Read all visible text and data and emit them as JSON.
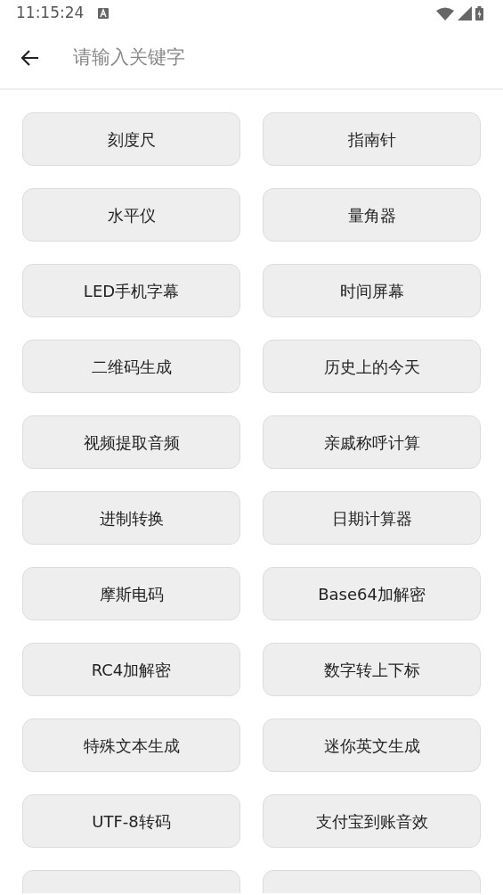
{
  "status_bar": {
    "time": "11:15:24"
  },
  "search": {
    "placeholder": "请输入关键字"
  },
  "tools": [
    {
      "label": "刻度尺"
    },
    {
      "label": "指南针"
    },
    {
      "label": "水平仪"
    },
    {
      "label": "量角器"
    },
    {
      "label": "LED手机字幕"
    },
    {
      "label": "时间屏幕"
    },
    {
      "label": "二维码生成"
    },
    {
      "label": "历史上的今天"
    },
    {
      "label": "视频提取音频"
    },
    {
      "label": "亲戚称呼计算"
    },
    {
      "label": "进制转换"
    },
    {
      "label": "日期计算器"
    },
    {
      "label": "摩斯电码"
    },
    {
      "label": "Base64加解密"
    },
    {
      "label": "RC4加解密"
    },
    {
      "label": "数字转上下标"
    },
    {
      "label": "特殊文本生成"
    },
    {
      "label": "迷你英文生成"
    },
    {
      "label": "UTF-8转码"
    },
    {
      "label": "支付宝到账音效"
    },
    {
      "kind": "cut"
    },
    {
      "kind": "cut"
    }
  ]
}
